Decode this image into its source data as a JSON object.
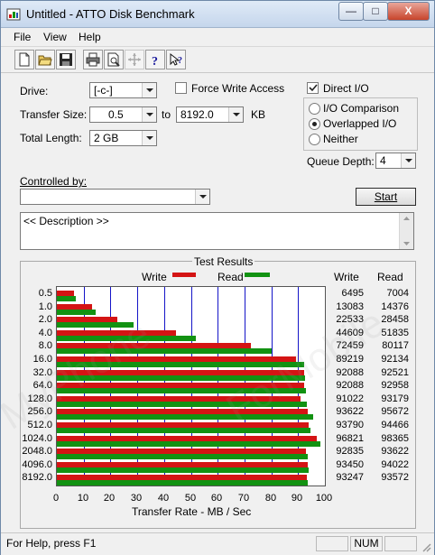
{
  "window": {
    "title": "Untitled - ATTO Disk Benchmark",
    "min_label": "—",
    "max_label": "□",
    "close_label": "X"
  },
  "menu": [
    "File",
    "View",
    "Help"
  ],
  "toolbar_icons": [
    "new-file-icon",
    "open-folder-icon",
    "save-disk-icon",
    "print-icon",
    "print-preview-icon",
    "move-icon",
    "help-icon",
    "context-help-icon"
  ],
  "controls": {
    "drive_label": "Drive:",
    "drive_value": "[-c-]",
    "force_write_label": "Force Write Access",
    "direct_io_label": "Direct I/O",
    "transfer_size_label": "Transfer Size:",
    "transfer_from": "0.5",
    "to_label": "to",
    "transfer_to": "8192.0",
    "unit_label": "KB",
    "total_length_label": "Total Length:",
    "total_length_value": "2 GB",
    "io_comparison_label": "I/O Comparison",
    "overlapped_io_label": "Overlapped I/O",
    "neither_label": "Neither",
    "queue_depth_label": "Queue Depth:",
    "queue_depth_value": "4",
    "controlled_by_label": "Controlled by:",
    "controlled_by_value": "",
    "start_label": "Start",
    "description_text": "<< Description >>"
  },
  "results": {
    "title": "Test Results",
    "legend_write": "Write",
    "legend_read": "Read",
    "col_write": "Write",
    "col_read": "Read",
    "xlabel": "Transfer Rate - MB / Sec"
  },
  "chart_data": {
    "type": "bar",
    "title": "Test Results",
    "xlabel": "Transfer Rate - MB / Sec",
    "xlim": [
      0,
      100
    ],
    "xticks": [
      "0",
      "10",
      "20",
      "30",
      "40",
      "50",
      "60",
      "70",
      "80",
      "90",
      "100"
    ],
    "categories": [
      "0.5",
      "1.0",
      "2.0",
      "4.0",
      "8.0",
      "16.0",
      "32.0",
      "64.0",
      "128.0",
      "256.0",
      "512.0",
      "1024.0",
      "2048.0",
      "4096.0",
      "8192.0"
    ],
    "series": [
      {
        "name": "Write",
        "color": "#d41414",
        "values": [
          6495,
          13083,
          22533,
          44609,
          72459,
          89219,
          92088,
          92088,
          91022,
          93622,
          93790,
          96821,
          92835,
          93450,
          93247
        ]
      },
      {
        "name": "Read",
        "color": "#129212",
        "values": [
          7004,
          14376,
          28458,
          51835,
          80117,
          92134,
          92521,
          92958,
          93179,
          95672,
          94466,
          98365,
          93622,
          94022,
          93572
        ]
      }
    ]
  },
  "status": {
    "text": "For Help, press F1",
    "num": "NUM"
  }
}
